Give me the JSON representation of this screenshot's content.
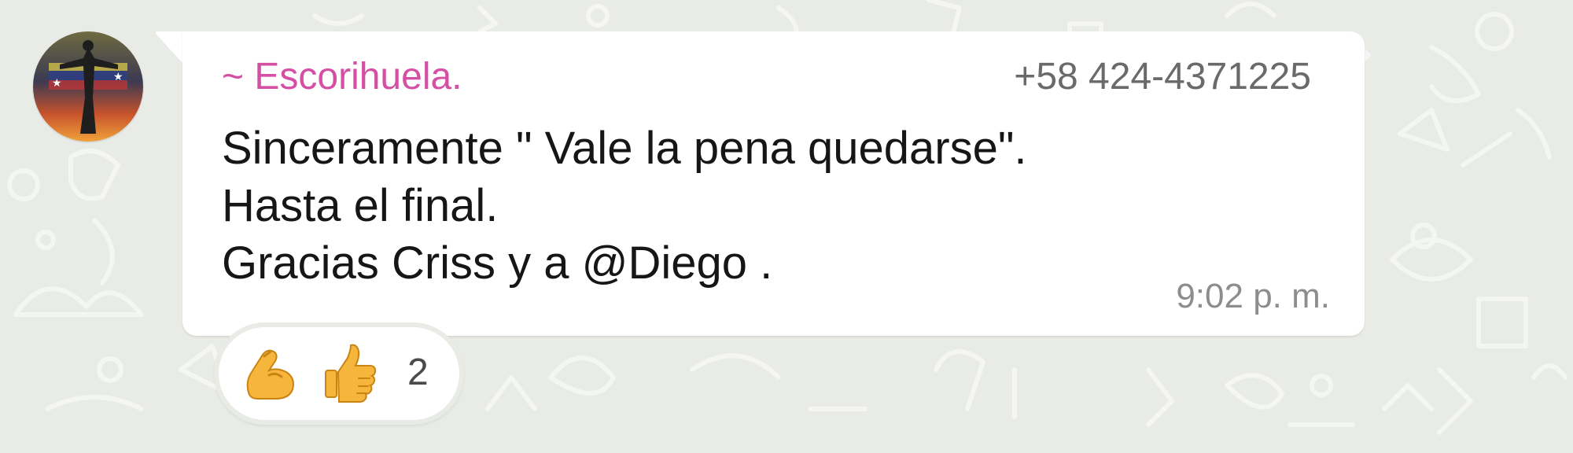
{
  "chat": {
    "background_color": "#e9ebe6",
    "message": {
      "sender_name": "~ Escorihuela.",
      "sender_name_color": "#d54fa5",
      "sender_phone": "+58 424-4371225",
      "lines": [
        "Sinceramente \" Vale la pena quedarse\".",
        "Hasta el final.",
        "Gracias Criss y a @Diego ."
      ],
      "time": "9:02 p. m.",
      "avatar": "sender-avatar-sunset-photo"
    },
    "reactions": {
      "emojis": [
        "flexed-biceps-icon",
        "thumbs-up-icon"
      ],
      "count": "2"
    }
  }
}
